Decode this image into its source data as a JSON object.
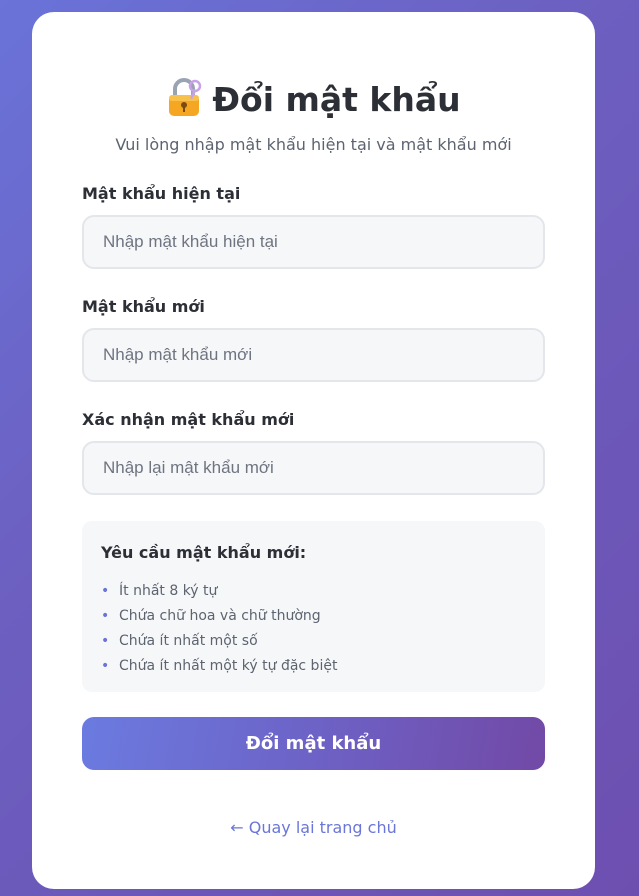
{
  "header": {
    "icon": "lock-with-key-icon",
    "title": "Đổi mật khẩu",
    "subtitle": "Vui lòng nhập mật khẩu hiện tại và mật khẩu mới"
  },
  "form": {
    "current_password": {
      "label": "Mật khẩu hiện tại",
      "placeholder": "Nhập mật khẩu hiện tại",
      "value": ""
    },
    "new_password": {
      "label": "Mật khẩu mới",
      "placeholder": "Nhập mật khẩu mới",
      "value": ""
    },
    "confirm_password": {
      "label": "Xác nhận mật khẩu mới",
      "placeholder": "Nhập lại mật khẩu mới",
      "value": ""
    }
  },
  "requirements": {
    "title": "Yêu cầu mật khẩu mới:",
    "items": [
      "Ít nhất 8 ký tự",
      "Chứa chữ hoa và chữ thường",
      "Chứa ít nhất một số",
      "Chứa ít nhất một ký tự đặc biệt"
    ]
  },
  "submit_label": "Đổi mật khẩu",
  "back_link": "← Quay lại trang chủ",
  "colors": {
    "background_start": "#6a73d9",
    "background_end": "#6d4fb0",
    "accent": "#6a76d8",
    "button_start": "#6b7be0",
    "button_end": "#7249a6"
  }
}
